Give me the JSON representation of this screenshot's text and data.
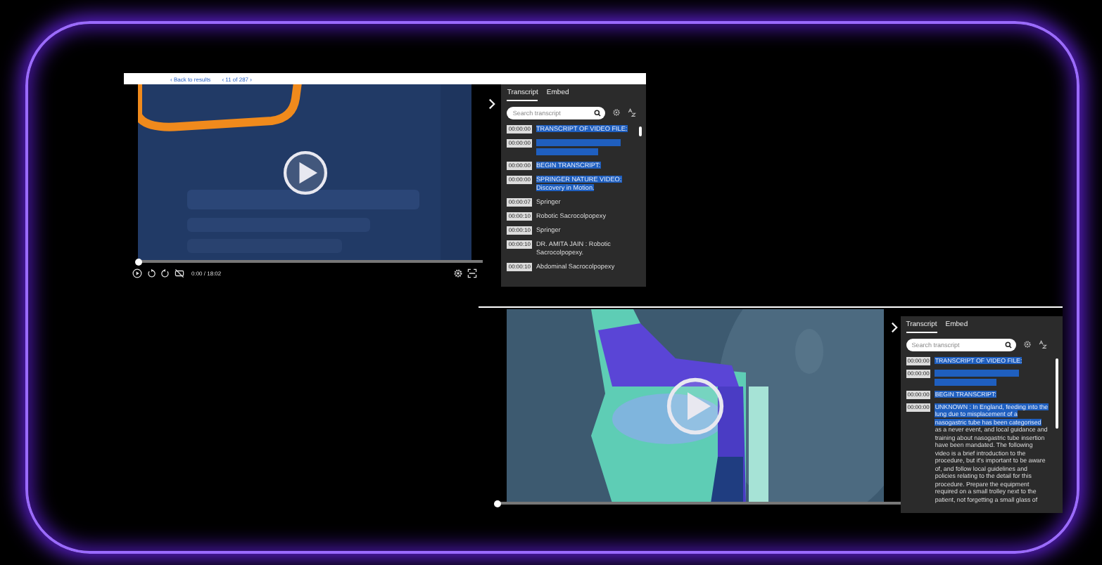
{
  "players": [
    {
      "top_bar": {
        "back_link": "‹ Back to results",
        "pager": "‹ 11 of 287 ›"
      },
      "progress": {
        "level": 0.0
      },
      "controls": {
        "time": "0:00 / 18:02"
      },
      "transcript": {
        "tabs": [
          {
            "label": "Transcript",
            "selected": true
          },
          {
            "label": "Embed",
            "selected": false
          }
        ],
        "search": {
          "placeholder": "Search transcript"
        },
        "entries": [
          {
            "time": "00:00:00",
            "kind": "text",
            "segments": [
              {
                "text": "TRANSCRIPT OF VIDEO FILE:",
                "highlighted": true
              }
            ]
          },
          {
            "time": "00:00:00",
            "kind": "redacted"
          },
          {
            "time": "00:00:00",
            "kind": "text",
            "segments": [
              {
                "text": "BEGIN TRANSCRIPT:",
                "highlighted": true
              }
            ]
          },
          {
            "time": "00:00:00",
            "kind": "text",
            "segments": [
              {
                "text": "SPRINGER NATURE VIDEO: Discovery in Motion.",
                "highlighted": true
              }
            ]
          },
          {
            "time": "00:00:07",
            "kind": "text",
            "segments": [
              {
                "text": "Springer",
                "highlighted": false
              }
            ]
          },
          {
            "time": "00:00:10",
            "kind": "text",
            "segments": [
              {
                "text": "Robotic Sacrocolpopexy",
                "highlighted": false
              }
            ]
          },
          {
            "time": "00:00:10",
            "kind": "text",
            "segments": [
              {
                "text": "Springer",
                "highlighted": false
              }
            ]
          },
          {
            "time": "00:00:10",
            "kind": "text",
            "segments": [
              {
                "text": "DR. AMITA JAIN : Robotic Sacrocolpopexy.",
                "highlighted": false
              }
            ]
          },
          {
            "time": "00:00:10",
            "kind": "text",
            "segments": [
              {
                "text": "Abdominal Sacrocolpopexy",
                "highlighted": false
              }
            ]
          }
        ]
      }
    },
    {
      "progress": {
        "level": 0.0
      },
      "transcript": {
        "tabs": [
          {
            "label": "Transcript",
            "selected": true
          },
          {
            "label": "Embed",
            "selected": false
          }
        ],
        "search": {
          "placeholder": "Search transcript"
        },
        "entries": [
          {
            "time": "00:00:00",
            "kind": "text",
            "segments": [
              {
                "text": "TRANSCRIPT OF VIDEO FILE:",
                "highlighted": true
              }
            ]
          },
          {
            "time": "00:00:00",
            "kind": "redacted"
          },
          {
            "time": "00:00:00",
            "kind": "text",
            "segments": [
              {
                "text": "BEGIN TRANSCRIPT:",
                "highlighted": true
              }
            ]
          },
          {
            "time": "00:00:00",
            "kind": "text",
            "segments": [
              {
                "text": "UNKNOWN : In England, feeding into the lung due to misplacement of a nasogastric tube has been categorised",
                "highlighted": true
              },
              {
                "text": " as a never event, and local guidance and training about nasogastric tube insertion have been mandated. The following video is a brief introduction to the procedure, but it's important to be aware of, and follow local guidelines and policies relating to the detail for this procedure. Prepare the equipment required on a small trolley next to the patient, not forgetting a small glass of",
                "highlighted": false
              }
            ]
          }
        ]
      }
    }
  ]
}
